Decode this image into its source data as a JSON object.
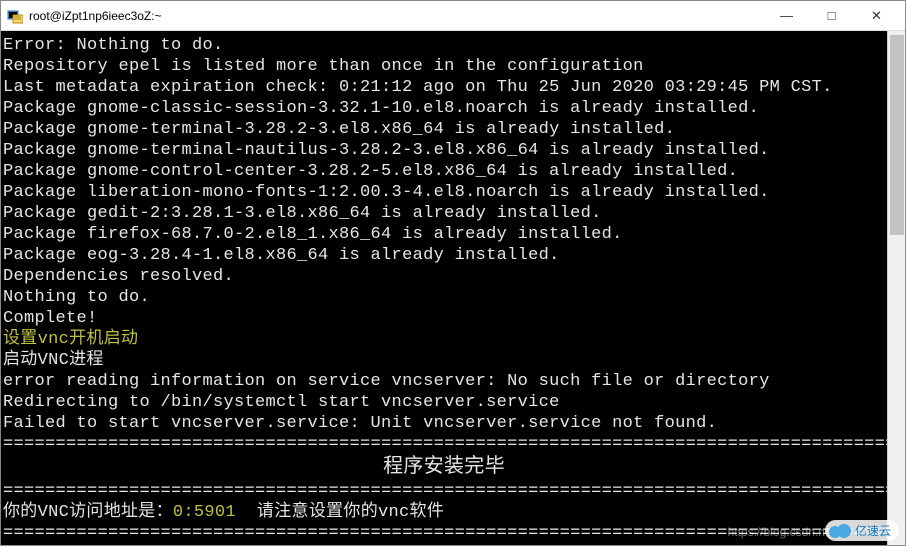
{
  "window": {
    "title": "root@iZpt1np6ieec3oZ:~",
    "icon": "putty-icon"
  },
  "controls": {
    "minimize": "—",
    "maximize": "□",
    "close": "✕"
  },
  "terminal": {
    "lines": [
      {
        "text": "Error: Nothing to do.",
        "cls": ""
      },
      {
        "text": "Repository epel is listed more than once in the configuration",
        "cls": ""
      },
      {
        "text": "Last metadata expiration check: 0:21:12 ago on Thu 25 Jun 2020 03:29:45 PM CST.",
        "cls": ""
      },
      {
        "text": "Package gnome-classic-session-3.32.1-10.el8.noarch is already installed.",
        "cls": ""
      },
      {
        "text": "Package gnome-terminal-3.28.2-3.el8.x86_64 is already installed.",
        "cls": ""
      },
      {
        "text": "Package gnome-terminal-nautilus-3.28.2-3.el8.x86_64 is already installed.",
        "cls": ""
      },
      {
        "text": "Package gnome-control-center-3.28.2-5.el8.x86_64 is already installed.",
        "cls": ""
      },
      {
        "text": "Package liberation-mono-fonts-1:2.00.3-4.el8.noarch is already installed.",
        "cls": ""
      },
      {
        "text": "Package gedit-2:3.28.1-3.el8.x86_64 is already installed.",
        "cls": ""
      },
      {
        "text": "Package firefox-68.7.0-2.el8_1.x86_64 is already installed.",
        "cls": ""
      },
      {
        "text": "Package eog-3.28.4-1.el8.x86_64 is already installed.",
        "cls": ""
      },
      {
        "text": "Dependencies resolved.",
        "cls": ""
      },
      {
        "text": "Nothing to do.",
        "cls": ""
      },
      {
        "text": "Complete!",
        "cls": ""
      },
      {
        "text": "设置vnc开机启动",
        "cls": "yellow"
      },
      {
        "text": "启动VNC进程",
        "cls": ""
      },
      {
        "text": "error reading information on service vncserver: No such file or directory",
        "cls": ""
      },
      {
        "text": "Redirecting to /bin/systemctl start vncserver.service",
        "cls": ""
      },
      {
        "text": "Failed to start vncserver.service: Unit vncserver.service not found.",
        "cls": ""
      },
      {
        "text": "=======================================================================================",
        "cls": "sep"
      },
      {
        "text": "程序安装完毕",
        "cls": "center-line"
      },
      {
        "text": "=======================================================================================",
        "cls": "sep"
      }
    ],
    "final_line": {
      "prefix": "你的VNC访问地址是：",
      "address": "0:5901",
      "suffix": "  请注意设置你的vnc软件"
    },
    "bottom_sep": "======================================================================================="
  },
  "watermark": {
    "url": "https://blog.csdn.net/g",
    "logo_text": "亿速云"
  }
}
